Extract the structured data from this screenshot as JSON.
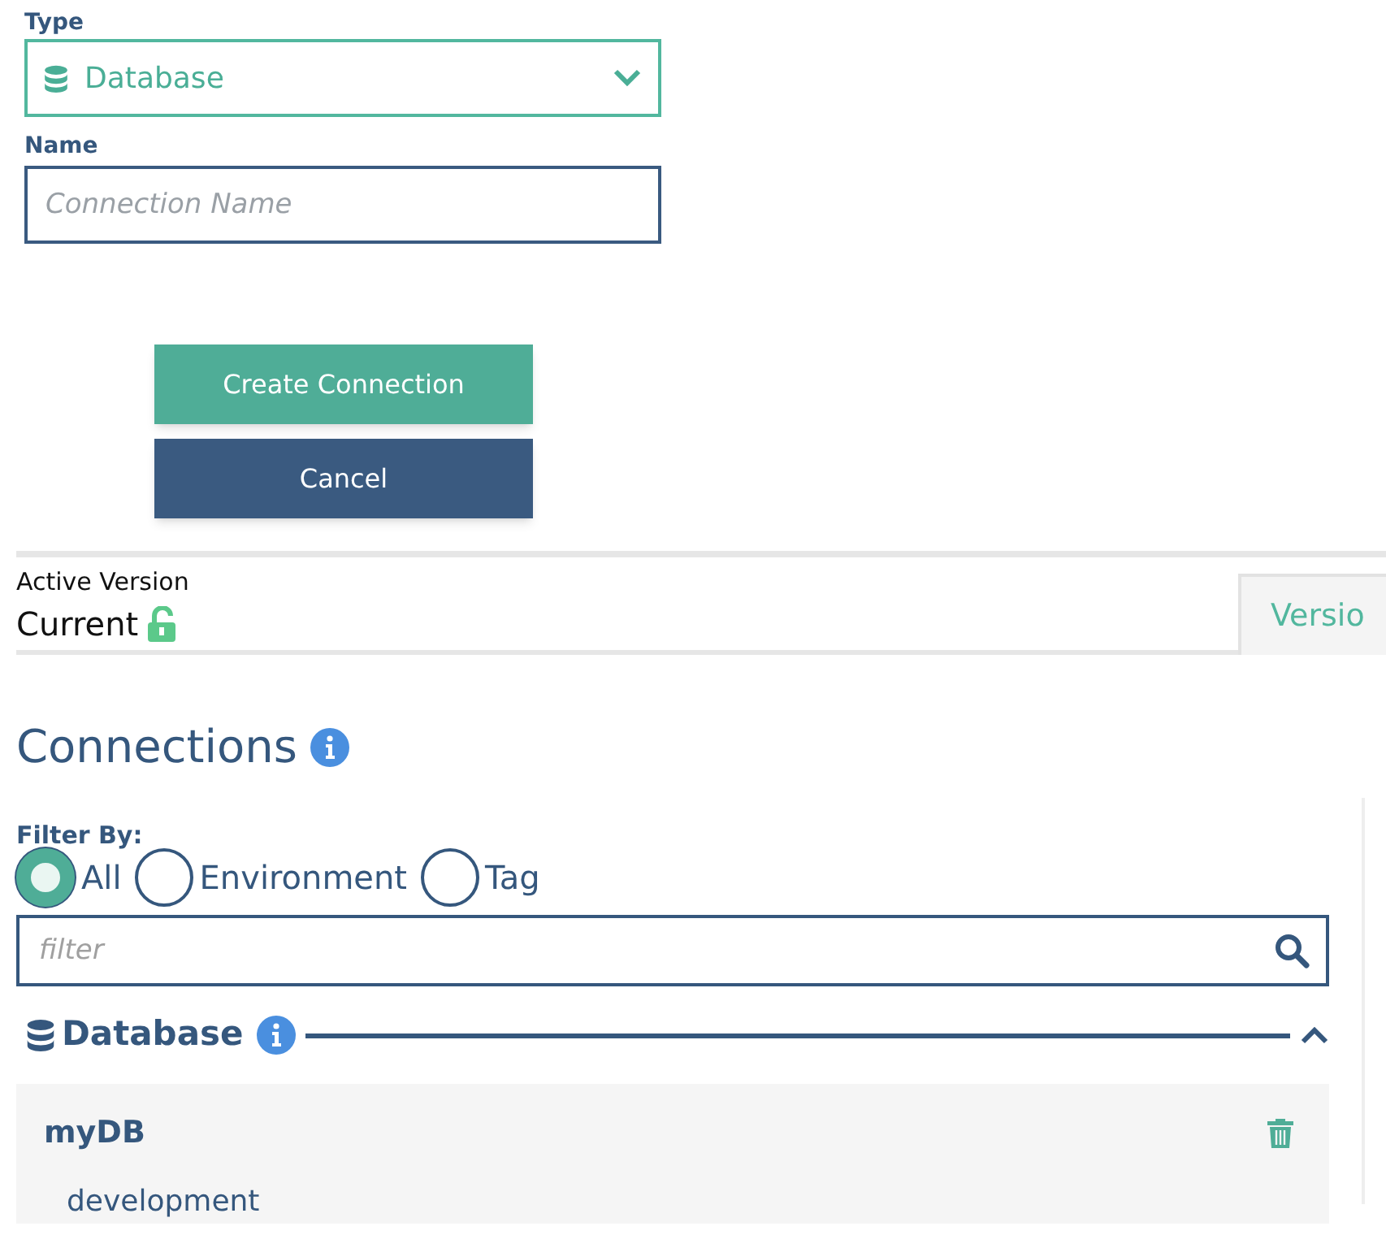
{
  "form": {
    "type_label": "Type",
    "type_value": "Database",
    "name_label": "Name",
    "name_placeholder": "Connection Name",
    "buttons": [
      {
        "label": "Create Connection",
        "kind": "primary"
      },
      {
        "label": "Cancel",
        "kind": "secondary"
      }
    ]
  },
  "version": {
    "label": "Active Version",
    "value": "Current",
    "unlocked": true,
    "tab": "Versio"
  },
  "connections": {
    "title": "Connections",
    "filter_label": "Filter By:",
    "filters": [
      {
        "label": "All",
        "selected": true
      },
      {
        "label": "Environment",
        "selected": false
      },
      {
        "label": "Tag",
        "selected": false
      }
    ],
    "filter_placeholder": "filter",
    "section": {
      "title": "Database",
      "expanded": true,
      "items": [
        {
          "name": "myDB",
          "environment": "development"
        }
      ]
    }
  }
}
